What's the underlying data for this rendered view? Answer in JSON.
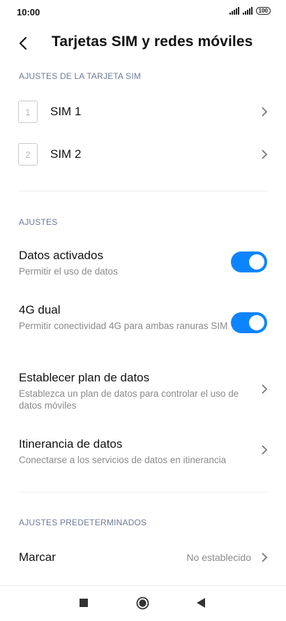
{
  "status_bar": {
    "time": "10:00",
    "battery": "100"
  },
  "header": {
    "title": "Tarjetas SIM y redes móviles"
  },
  "sim_section": {
    "label": "AJUSTES DE LA TARJETA SIM",
    "items": [
      {
        "number": "1",
        "label": "SIM 1"
      },
      {
        "number": "2",
        "label": "SIM 2"
      }
    ]
  },
  "settings_section": {
    "label": "AJUSTES",
    "items": [
      {
        "title": "Datos activados",
        "subtitle": "Permitir el uso de datos",
        "toggle": true
      },
      {
        "title": "4G dual",
        "subtitle": "Permitir conectividad 4G para ambas ranuras SIM",
        "toggle": true
      },
      {
        "title": "Establecer plan de datos",
        "subtitle": "Establezca un plan de datos para controlar el uso de datos móviles"
      },
      {
        "title": "Itinerancia de datos",
        "subtitle": "Conectarse a los servicios de datos en itinerancia"
      }
    ]
  },
  "default_section": {
    "label": "AJUSTES PREDETERMINADOS",
    "items": [
      {
        "title": "Marcar",
        "value": "No establecido"
      }
    ]
  },
  "colors": {
    "accent": "#0d84ff",
    "section_label": "#6b7a99",
    "subtitle": "#8a8a8a"
  },
  "icons": [
    "back-arrow-icon",
    "chevron-right-icon",
    "square-icon",
    "circle-icon",
    "triangle-icon"
  ]
}
